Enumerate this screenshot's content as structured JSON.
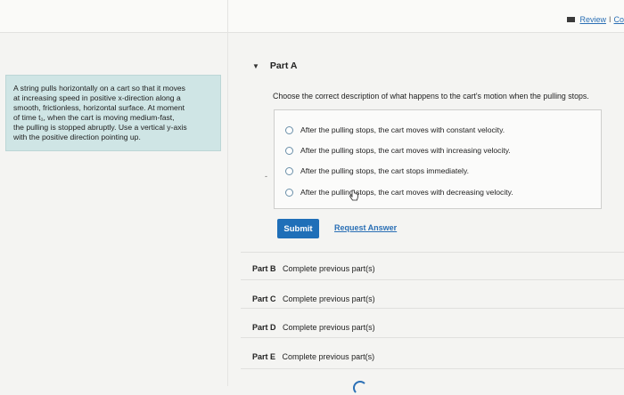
{
  "header": {
    "review_label": "Review",
    "separator": "I",
    "constants_label": "Co"
  },
  "problem": {
    "text_lines": [
      "A string pulls horizontally on a cart so that it moves",
      "at increasing speed in positive x-direction along a",
      "smooth, frictionless, horizontal surface. At moment",
      "of time t₁, when the cart is moving medium-fast,",
      "the pulling is stopped abruptly. Use a vertical y-axis",
      "with the positive direction pointing up."
    ]
  },
  "part_a": {
    "label": "Part A",
    "question": "Choose the correct description of what happens to the cart's motion when the pulling stops.",
    "options": [
      "After the pulling stops,  the cart moves with constant velocity.",
      "After the pulling stops,  the cart moves with increasing velocity.",
      "After the pulling stops, the cart stops immediately.",
      "After the pulling stops,  the cart moves with decreasing velocity."
    ],
    "marker": "-",
    "submit_label": "Submit",
    "request_answer_label": "Request Answer"
  },
  "other_parts": [
    {
      "label": "Part B",
      "status": "Complete previous part(s)"
    },
    {
      "label": "Part C",
      "status": "Complete previous part(s)"
    },
    {
      "label": "Part D",
      "status": "Complete previous part(s)"
    },
    {
      "label": "Part E",
      "status": "Complete previous part(s)"
    }
  ],
  "colors": {
    "accent": "#1f6fb8",
    "link": "#2a6fb5",
    "problem_panel": "#cfe5e5"
  },
  "icons": {
    "review": "grid-icon",
    "part_a_toggle": "caret-down-icon",
    "pointer": "hand-cursor-icon",
    "loading": "spinner-icon"
  }
}
